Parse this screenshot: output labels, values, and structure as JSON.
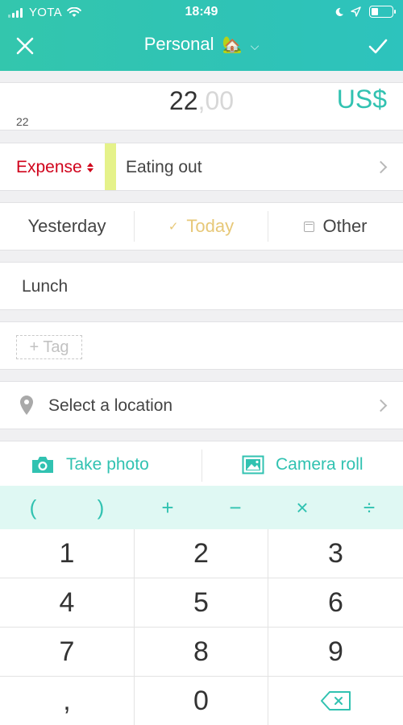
{
  "status_bar": {
    "carrier": "YOTA",
    "time": "18:49"
  },
  "nav": {
    "title": "Personal",
    "title_emoji": "🏡",
    "close_icon": "close-icon",
    "confirm_icon": "check-icon"
  },
  "amount": {
    "integer": "22",
    "decimal": ",00",
    "currency": "US$",
    "expression": "22"
  },
  "transaction": {
    "type_label": "Expense",
    "category_name": "Eating out",
    "category_color": "#e5f28a"
  },
  "dates": {
    "yesterday": "Yesterday",
    "today": "Today",
    "other": "Other",
    "selected": "Today"
  },
  "note": "Lunch",
  "tag_button": "+ Tag",
  "location": "Select a location",
  "photos": {
    "take_photo": "Take photo",
    "camera_roll": "Camera roll"
  },
  "operators": [
    "(",
    ")",
    "+",
    "−",
    "×",
    "÷"
  ],
  "keypad": {
    "keys": [
      "1",
      "2",
      "3",
      "4",
      "5",
      "6",
      "7",
      "8",
      "9",
      ",",
      "0"
    ],
    "backspace_icon": "backspace-icon"
  },
  "colors": {
    "accent": "#31c2b1",
    "expense": "#d0021b",
    "today": "#e7c878"
  }
}
